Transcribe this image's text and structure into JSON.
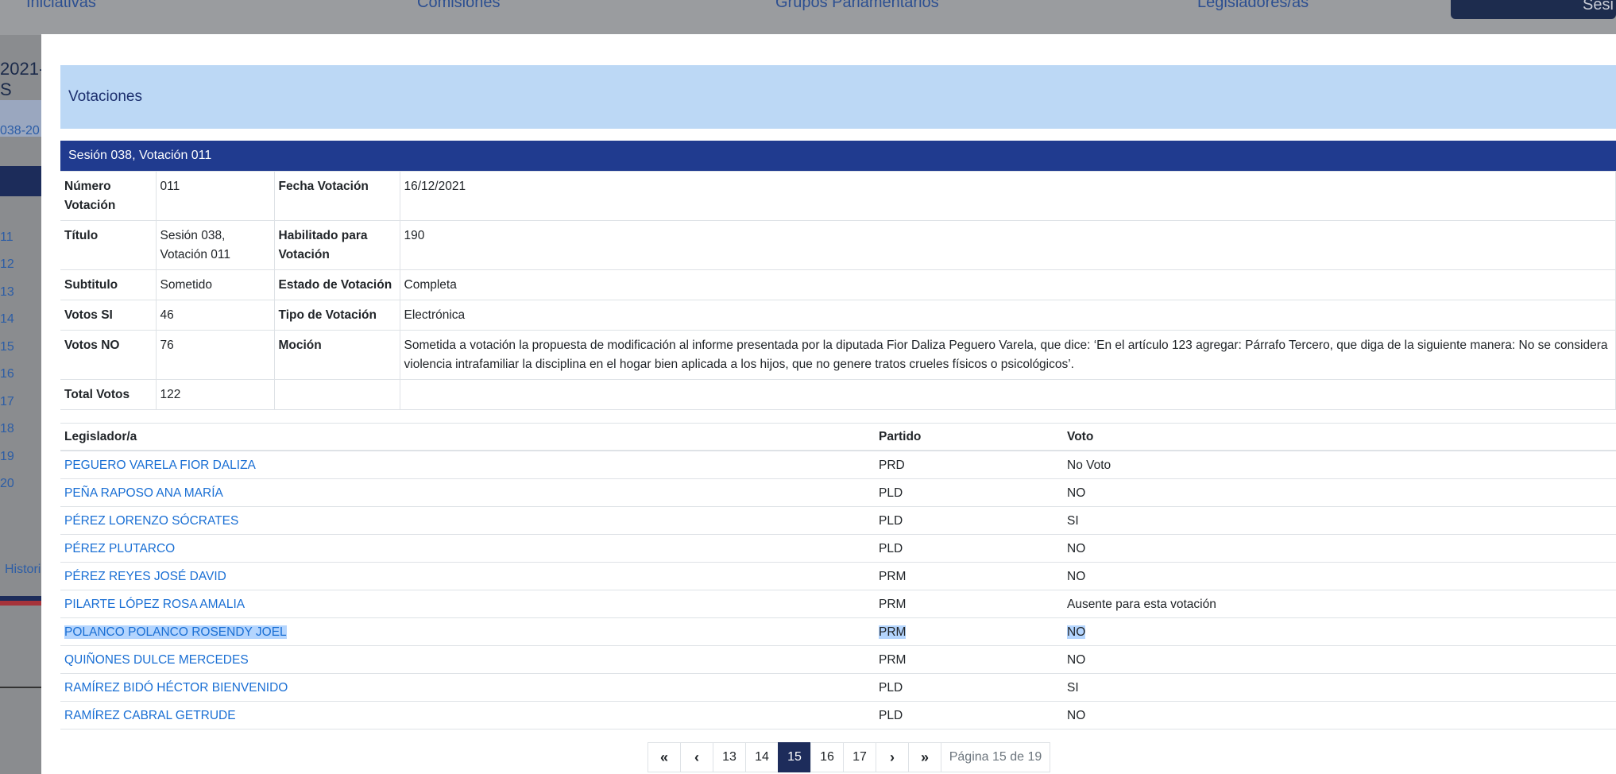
{
  "background": {
    "nav": [
      "Iniciativas",
      "Comisiones",
      "Grupos Parlamentarios",
      "Legisladores/as"
    ],
    "nav_button": "Sesi",
    "left_header": "2021-S",
    "left_link": "038-20",
    "left_numbers": [
      "11",
      "12",
      "13",
      "14",
      "15",
      "16",
      "17",
      "18",
      "19",
      "20"
    ],
    "left_historial": "Histori"
  },
  "modal": {
    "title": "Votaciones",
    "session_title": "Sesión 038, Votación 011",
    "info": {
      "numero_label": "Número Votación",
      "numero_value": "011",
      "fecha_label": "Fecha Votación",
      "fecha_value": "16/12/2021",
      "titulo_label": "Título",
      "titulo_value": "Sesión 038, Votación 011",
      "habilitado_label": "Habilitado para Votación",
      "habilitado_value": "190",
      "subtitulo_label": "Subtitulo",
      "subtitulo_value": "Sometido",
      "estado_label": "Estado de Votación",
      "estado_value": "Completa",
      "votos_si_label": "Votos SI",
      "votos_si_value": "46",
      "tipo_label": "Tipo de Votación",
      "tipo_value": "Electrónica",
      "votos_no_label": "Votos NO",
      "votos_no_value": "76",
      "mocion_label": "Moción",
      "mocion_value": "Sometida a votación la propuesta de modificación al informe presentada por la diputada Fior Daliza Peguero Varela, que dice: ‘En el artículo 123 agregar: Párrafo Tercero, que diga de la siguiente manera: No se considera violencia intrafamiliar la disciplina en el hogar bien aplicada a los hijos, que no genere tratos crueles físicos o psicológicos’.",
      "total_label": "Total Votos",
      "total_value": "122"
    },
    "columns": {
      "legislador": "Legislador/a",
      "partido": "Partido",
      "voto": "Voto"
    },
    "rows": [
      {
        "name": "PEGUERO VARELA FIOR DALIZA",
        "party": "PRD",
        "vote": "No Voto"
      },
      {
        "name": "PEÑA RAPOSO ANA MARÍA",
        "party": "PLD",
        "vote": "NO"
      },
      {
        "name": "PÉREZ LORENZO SÓCRATES",
        "party": "PLD",
        "vote": "SI"
      },
      {
        "name": "PÉREZ PLUTARCO",
        "party": "PLD",
        "vote": "NO"
      },
      {
        "name": "PÉREZ REYES JOSÉ DAVID",
        "party": "PRM",
        "vote": "NO"
      },
      {
        "name": "PILARTE LÓPEZ ROSA AMALIA",
        "party": "PRM",
        "vote": "Ausente para esta votación"
      },
      {
        "name": "POLANCO POLANCO ROSENDY JOEL",
        "party": "PRM",
        "vote": "NO"
      },
      {
        "name": "QUIÑONES DULCE MERCEDES",
        "party": "PRM",
        "vote": "NO"
      },
      {
        "name": "RAMÍREZ BIDÓ HÉCTOR BIENVENIDO",
        "party": "PLD",
        "vote": "SI"
      },
      {
        "name": "RAMÍREZ CABRAL GETRUDE",
        "party": "PLD",
        "vote": "NO"
      }
    ],
    "pagination": {
      "first": "«",
      "prev": "‹",
      "pages": [
        "13",
        "14",
        "15",
        "16",
        "17"
      ],
      "active_page": "15",
      "next": "›",
      "last": "»",
      "info": "Página 15 de 19"
    }
  }
}
